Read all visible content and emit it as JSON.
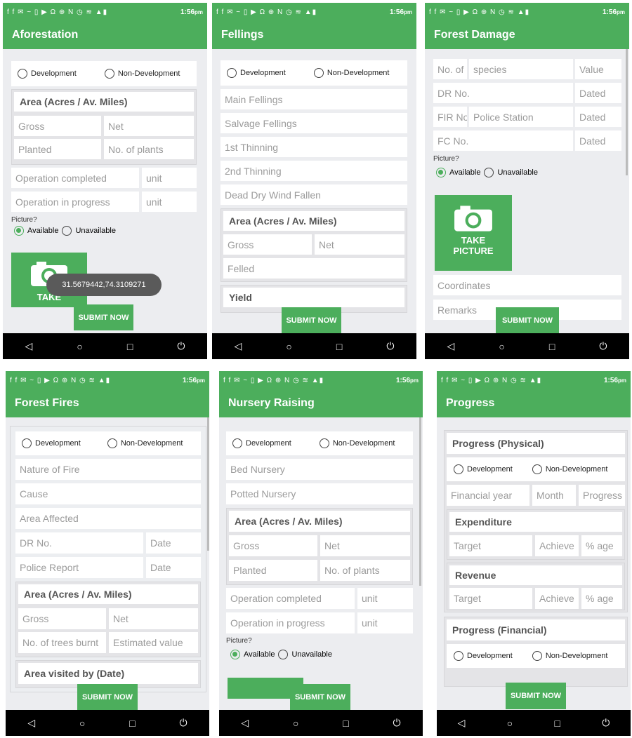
{
  "status": {
    "time": "1:56",
    "ampm": "pm",
    "icons": "f f ✉ ~ ▯ ▶ Ω ⊕ N ◷ ≋ ▲▮"
  },
  "common": {
    "development": "Development",
    "non_development": "Non-Development",
    "picture_label": "Picture?",
    "available": "Available",
    "unavailable": "Unavailable",
    "submit": "SUBMIT NOW",
    "nav": [
      "◁",
      "○",
      "□",
      "⏻"
    ]
  },
  "afforestation": {
    "title": "Aforestation",
    "area_header": "Area (Acres / Av. Miles)",
    "gross": "Gross",
    "net": "Net",
    "planted": "Planted",
    "plants": "No. of plants",
    "op_completed": "Operation completed",
    "op_progress": "Operation in progress",
    "unit": "unit",
    "take_picture": "TAKE",
    "toast": "31.5679442,74.3109271"
  },
  "fellings": {
    "title": "Fellings",
    "main": "Main Fellings",
    "salvage": "Salvage Fellings",
    "thin1": "1st Thinning",
    "thin2": "2nd Thinning",
    "dead": "Dead Dry Wind Fallen",
    "area_header": "Area (Acres / Av. Miles)",
    "gross": "Gross",
    "net": "Net",
    "felled": "Felled",
    "yield": "Yield"
  },
  "damage": {
    "title": "Forest Damage",
    "no_of": "No. of",
    "species": "species",
    "value": "Value",
    "dr_no": "DR No.",
    "dated": "Dated",
    "fir": "FIR No",
    "police_station": "Police Station",
    "fc_no": "FC No.",
    "take_picture_1": "TAKE",
    "take_picture_2": "PICTURE",
    "coordinates": "Coordinates",
    "remarks": "Remarks"
  },
  "fires": {
    "title": "Forest Fires",
    "nature": "Nature of Fire",
    "cause": "Cause",
    "area_affected": "Area Affected",
    "dr_no": "DR No.",
    "date": "Date",
    "police_report": "Police Report",
    "area_header": "Area (Acres / Av. Miles)",
    "gross": "Gross",
    "net": "Net",
    "trees_burnt": "No. of trees burnt",
    "est_value": "Estimated value",
    "visited": "Area visited by  (Date)"
  },
  "nursery": {
    "title": "Nursery Raising",
    "bed": "Bed Nursery",
    "potted": "Potted Nursery",
    "area_header": "Area (Acres / Av. Miles)",
    "gross": "Gross",
    "net": "Net",
    "planted": "Planted",
    "plants": "No. of plants",
    "op_completed": "Operation completed",
    "op_progress": "Operation in progress",
    "unit": "unit"
  },
  "progress": {
    "title": "Progress",
    "physical": "Progress (Physical)",
    "fin_year": "Financial year",
    "month": "Month",
    "progress": "Progress",
    "expenditure": "Expenditure",
    "target": "Target",
    "achieve": "Achieve",
    "age": "% age",
    "revenue": "Revenue",
    "financial": "Progress (Financial)"
  },
  "colors": {
    "accent": "#4cae5c",
    "background": "#ecedf0",
    "navbar": "#000000"
  }
}
